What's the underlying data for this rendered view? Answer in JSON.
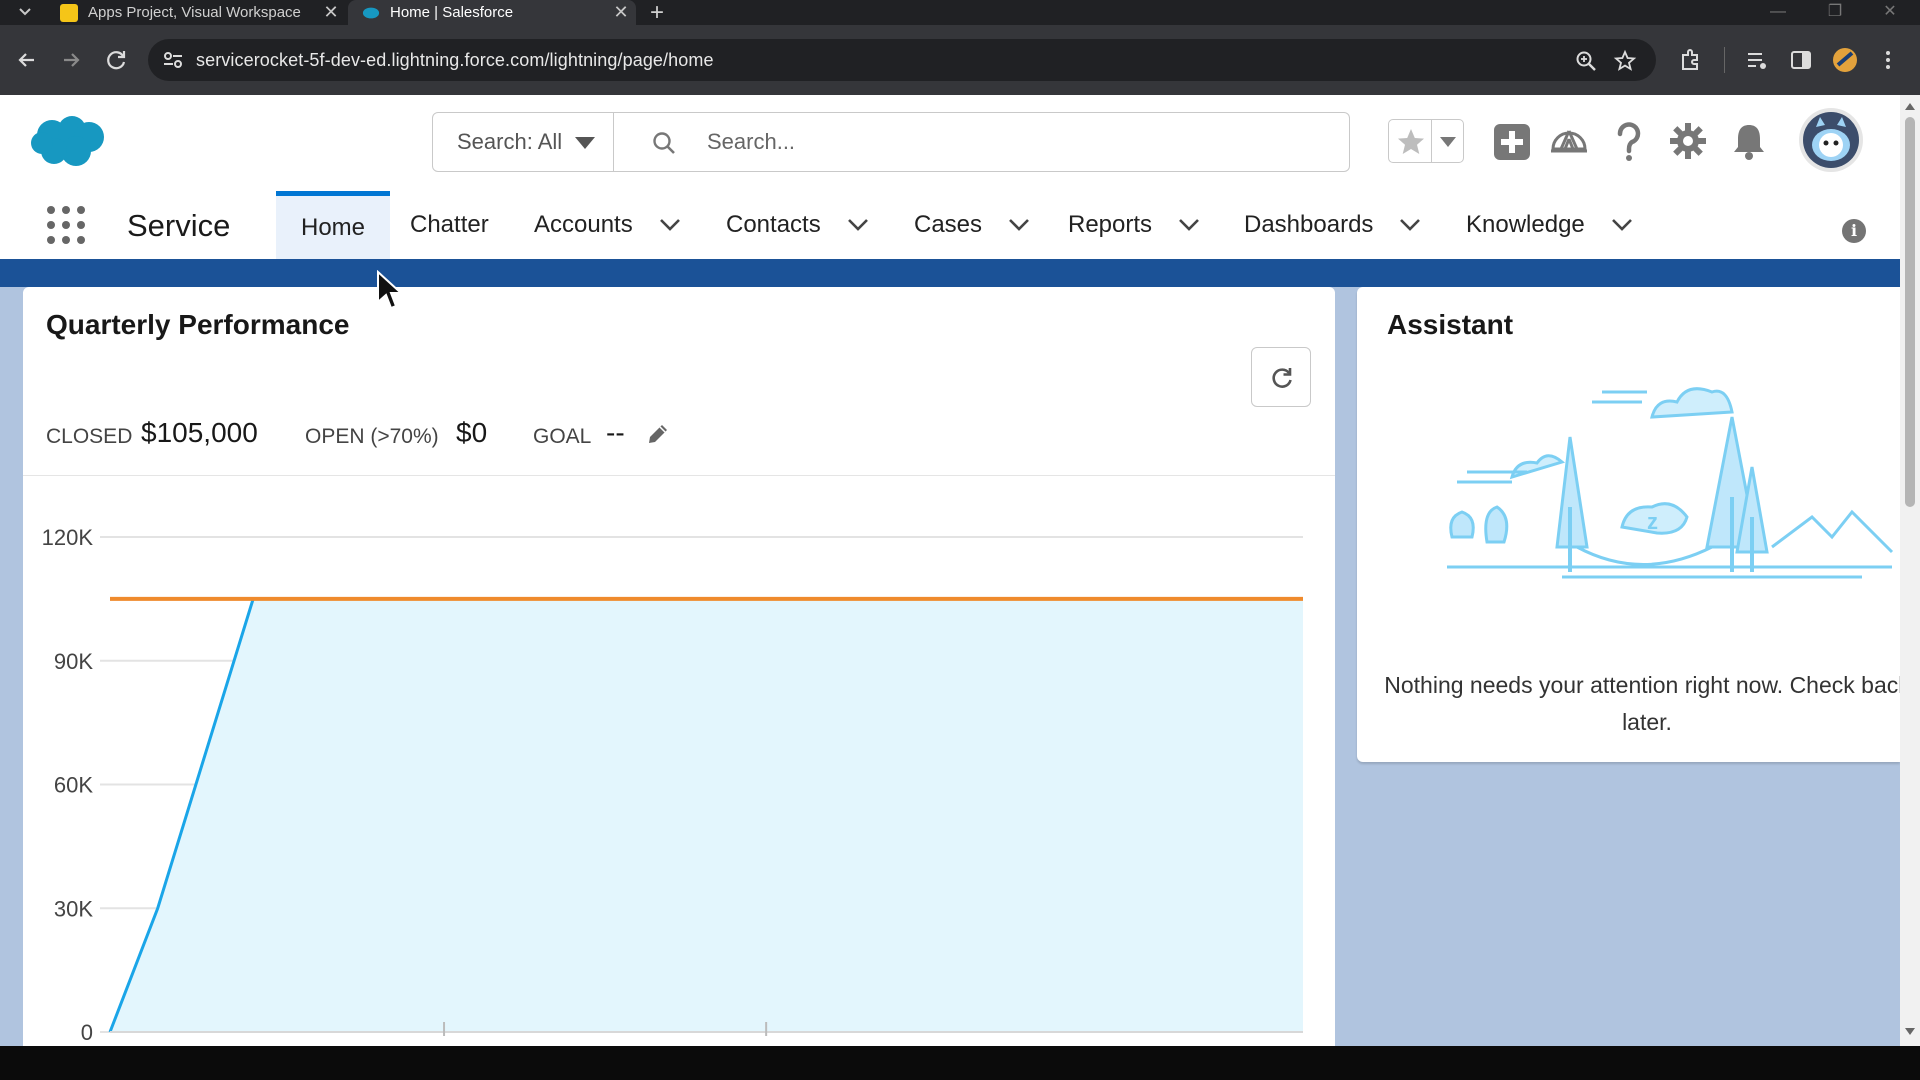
{
  "browser": {
    "tabs": [
      {
        "title": "Apps Project, Visual Workspace",
        "favicon_color": "#f5c518"
      },
      {
        "title": "Home | Salesforce",
        "favicon_color": "#1798c1",
        "active": true
      }
    ],
    "url": "servicerocket-5f-dev-ed.lightning.force.com/lightning/page/home"
  },
  "header": {
    "search_scope": "Search: All",
    "search_placeholder": "Search...",
    "brand_color": "#1798c1"
  },
  "nav": {
    "app_name": "Service",
    "items": [
      {
        "label": "Home",
        "active": true
      },
      {
        "label": "Chatter"
      },
      {
        "label": "Accounts"
      },
      {
        "label": "Contacts"
      },
      {
        "label": "Cases"
      },
      {
        "label": "Reports"
      },
      {
        "label": "Dashboards"
      },
      {
        "label": "Knowledge"
      }
    ]
  },
  "quarterly_performance": {
    "title": "Quarterly Performance",
    "closed_label": "CLOSED",
    "closed_value": "$105,000",
    "open_label": "OPEN (>70%)",
    "open_value": "$0",
    "goal_label": "GOAL",
    "goal_value": "--"
  },
  "chart_data": {
    "type": "area",
    "y_ticks": [
      "120K",
      "90K",
      "60K",
      "30K",
      "0"
    ],
    "ylim": [
      0,
      120000
    ],
    "x": [
      0,
      4,
      12,
      100
    ],
    "xlim": [
      0,
      100
    ],
    "series": [
      {
        "values": [
          0,
          30000,
          105000,
          105000
        ],
        "color": "#1aa5e8",
        "fill": "#e3f6fd"
      },
      {
        "values": [
          105000,
          105000,
          105000,
          105000
        ],
        "color": "#ef8a2c"
      }
    ],
    "grid": true
  },
  "assistant": {
    "title": "Assistant",
    "message": "Nothing needs your attention right now. Check back later."
  }
}
